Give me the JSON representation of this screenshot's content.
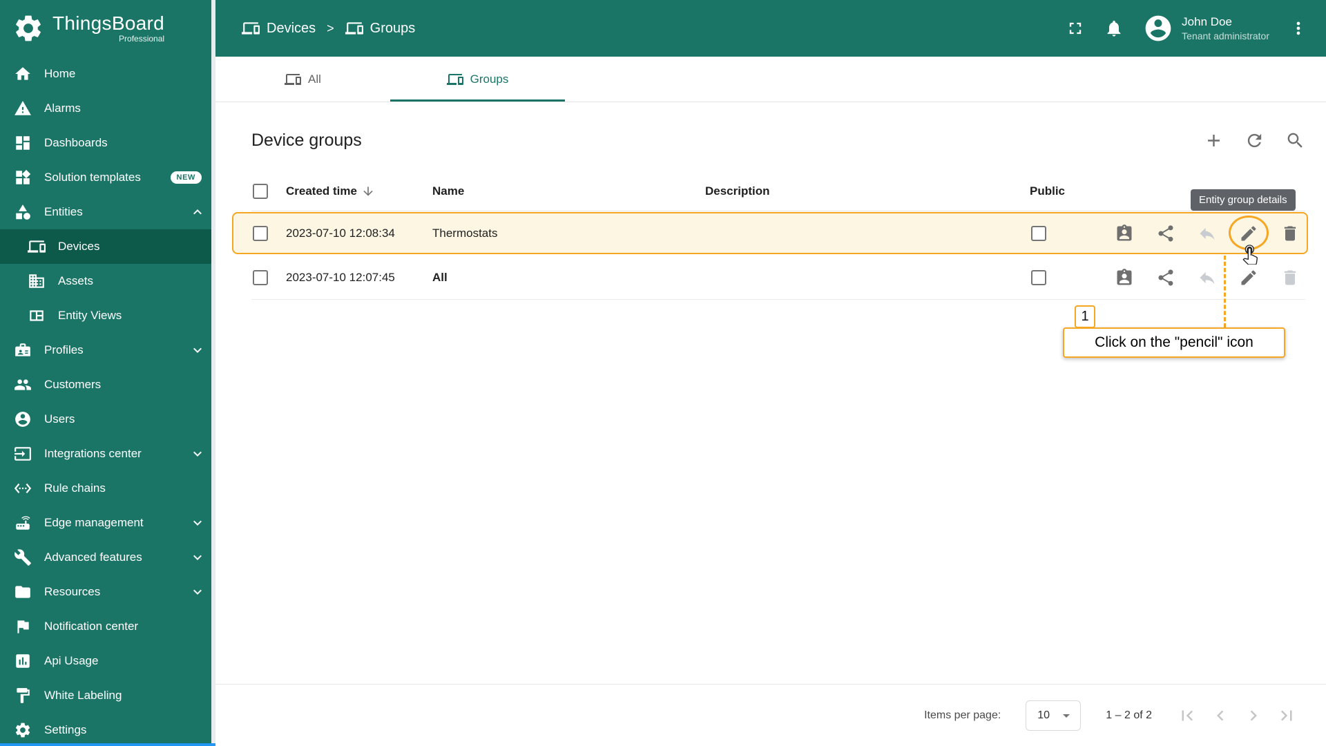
{
  "app": {
    "name": "ThingsBoard",
    "edition": "Professional"
  },
  "topbar": {
    "breadcrumb": [
      {
        "label": "Devices",
        "icon": "devices"
      },
      {
        "label": "Groups",
        "icon": "devices"
      }
    ],
    "separator": ">",
    "user": {
      "name": "John Doe",
      "role": "Tenant administrator"
    }
  },
  "sidebar": {
    "items": [
      {
        "label": "Home",
        "icon": "home"
      },
      {
        "label": "Alarms",
        "icon": "alarm"
      },
      {
        "label": "Dashboards",
        "icon": "dashboards"
      },
      {
        "label": "Solution templates",
        "icon": "solution-templates",
        "badge": "NEW"
      },
      {
        "label": "Entities",
        "icon": "entities",
        "expanded": true,
        "children": [
          {
            "label": "Devices",
            "icon": "devices",
            "selected": true
          },
          {
            "label": "Assets",
            "icon": "assets"
          },
          {
            "label": "Entity Views",
            "icon": "entity-views"
          }
        ]
      },
      {
        "label": "Profiles",
        "icon": "profiles",
        "expandable": true
      },
      {
        "label": "Customers",
        "icon": "customers"
      },
      {
        "label": "Users",
        "icon": "users"
      },
      {
        "label": "Integrations center",
        "icon": "integrations",
        "expandable": true
      },
      {
        "label": "Rule chains",
        "icon": "rule-chains"
      },
      {
        "label": "Edge management",
        "icon": "edge",
        "expandable": true
      },
      {
        "label": "Advanced features",
        "icon": "advanced",
        "expandable": true
      },
      {
        "label": "Resources",
        "icon": "resources",
        "expandable": true
      },
      {
        "label": "Notification center",
        "icon": "notification"
      },
      {
        "label": "Api Usage",
        "icon": "api-usage"
      },
      {
        "label": "White Labeling",
        "icon": "white-labeling"
      },
      {
        "label": "Settings",
        "icon": "settings"
      }
    ]
  },
  "tabs": [
    {
      "label": "All",
      "icon": "devices",
      "active": false
    },
    {
      "label": "Groups",
      "icon": "devices",
      "active": true
    }
  ],
  "group_table": {
    "title": "Device groups",
    "columns": [
      "Created time",
      "Name",
      "Description",
      "Public"
    ],
    "rows": [
      {
        "created_time": "2023-07-10 12:08:34",
        "name": "Thermostats",
        "description": "",
        "public": false,
        "highlighted": true,
        "name_bold": false,
        "actions": [
          {
            "name": "manage-users",
            "disabled": false
          },
          {
            "name": "share",
            "disabled": false
          },
          {
            "name": "make-private",
            "disabled": true
          },
          {
            "name": "edit",
            "disabled": false
          },
          {
            "name": "delete",
            "disabled": false
          }
        ]
      },
      {
        "created_time": "2023-07-10 12:07:45",
        "name": "All",
        "description": "",
        "public": false,
        "highlighted": false,
        "name_bold": true,
        "actions": [
          {
            "name": "manage-users",
            "disabled": false
          },
          {
            "name": "share",
            "disabled": false
          },
          {
            "name": "make-private",
            "disabled": true
          },
          {
            "name": "edit",
            "disabled": false
          },
          {
            "name": "delete",
            "disabled": true
          }
        ]
      }
    ]
  },
  "tooltip": {
    "text": "Entity group details"
  },
  "annotation": {
    "step": "1",
    "text": "Click on the \"pencil\" icon"
  },
  "paginator": {
    "label": "Items per page:",
    "value": "10",
    "range": "1 – 2 of 2"
  },
  "colors": {
    "primary": "#1b7566",
    "selected": "#0d5a4a",
    "accent": "#f5a623"
  }
}
